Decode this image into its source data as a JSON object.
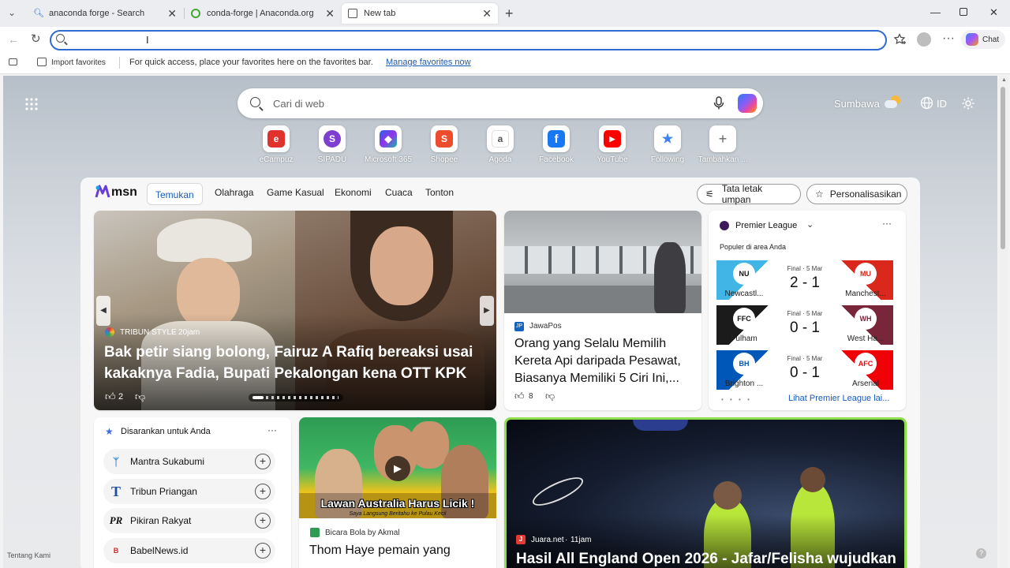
{
  "browser": {
    "tabs": [
      {
        "title": "anaconda forge - Search",
        "favicon": "bing-search-icon"
      },
      {
        "title": "conda-forge | Anaconda.org",
        "favicon": "anaconda-icon"
      },
      {
        "title": "New tab",
        "favicon": "newtab-icon"
      }
    ],
    "new_tab_symbol": "+",
    "address_value": "",
    "copilot_label": "Chat",
    "favbar": {
      "import_label": "Import favorites",
      "hint": "For quick access, place your favorites here on the favorites bar.",
      "manage_link": "Manage favorites now"
    }
  },
  "ntp": {
    "search_placeholder": "Cari di web",
    "location": "Sumbawa",
    "region": "ID",
    "quick_links": [
      {
        "label": "eCampuz",
        "glyph": "e",
        "color": "#e0312d"
      },
      {
        "label": "SIPADU",
        "glyph": "S",
        "color": "#7e3fd0"
      },
      {
        "label": "Microsoft 365",
        "glyph": "◆",
        "color": "#3a6ee0"
      },
      {
        "label": "Shopee",
        "glyph": "S",
        "color": "#ee4d2d"
      },
      {
        "label": "Agoda",
        "glyph": "a",
        "color": "#555555"
      },
      {
        "label": "Facebook",
        "glyph": "f",
        "color": "#1877f2"
      },
      {
        "label": "YouTube",
        "glyph": "▶",
        "color": "#ff0000"
      },
      {
        "label": "Following",
        "glyph": "★",
        "color": "#3b82f6"
      },
      {
        "label": "Tambahkan ...",
        "glyph": "+",
        "color": "#666666"
      }
    ],
    "about": "Tentang Kami"
  },
  "feed": {
    "brand": "msn",
    "nav": [
      "Temukan",
      "Olahraga",
      "Game Kasual",
      "Ekonomi",
      "Cuaca",
      "Tonton"
    ],
    "layout_btn": "Tata letak umpan",
    "personalize_btn": "Personalisasikan",
    "hero": {
      "source": "TRIBUN STYLE",
      "time": "20jam",
      "title": "Bak petir siang bolong, Fairuz A Rafiq bereaksi usai kakaknya Fadia, Bupati Pekalongan kena OTT KPK",
      "likes": "2",
      "slides": "14 / 1"
    },
    "story2": {
      "source": "JawaPos",
      "title": "Orang yang Selalu Memilih Kereta Api daripada Pesawat, Biasanya Memiliki 5 Ciri Ini,...",
      "likes": "8"
    },
    "league": {
      "name": "Premier League",
      "popular": "Populer di area Anda",
      "more": "Lihat Premier League lai...",
      "matches": [
        {
          "status": "Final · 5 Mar",
          "score": "2 - 1",
          "home": "Newcastl...",
          "away": "Manchest...",
          "home_color": "#41b6e6",
          "away_color": "#da291c",
          "home_crest": "NU",
          "away_crest": "MU"
        },
        {
          "status": "Final · 5 Mar",
          "score": "0 - 1",
          "home": "Fulham",
          "away": "West Ha...",
          "home_color": "#1b1b1b",
          "away_color": "#7a263a",
          "home_crest": "FFC",
          "away_crest": "WH"
        },
        {
          "status": "Final · 5 Mar",
          "score": "0 - 1",
          "home": "Brighton ...",
          "away": "Arsenal",
          "home_color": "#0057b8",
          "away_color": "#ef0107",
          "home_crest": "BH",
          "away_crest": "AFC"
        }
      ]
    },
    "suggested": {
      "title": "Disarankan untuk Anda",
      "items": [
        {
          "name": "Mantra Sukabumi",
          "logo": "ᛉ",
          "color": "#3a8fd6"
        },
        {
          "name": "Tribun Priangan",
          "logo": "T",
          "color": "#1e4fa0"
        },
        {
          "name": "Pikiran Rakyat",
          "logo": "PR",
          "color": "#111111"
        },
        {
          "name": "BabelNews.id",
          "logo": "B",
          "color": "#c62828"
        }
      ]
    },
    "video": {
      "source": "Bicara Bola by Akmal",
      "title": "Thom Haye pemain yang",
      "overlay": "Lawan Australia Harus Licik !",
      "overlay_sub": "Saya Langsung Beritahu ke Pulau Kecil"
    },
    "badminton": {
      "source": "Juara.net",
      "time": "11jam",
      "title": "Hasil All England Open 2026 - Jafar/Felisha wujudkan"
    }
  }
}
